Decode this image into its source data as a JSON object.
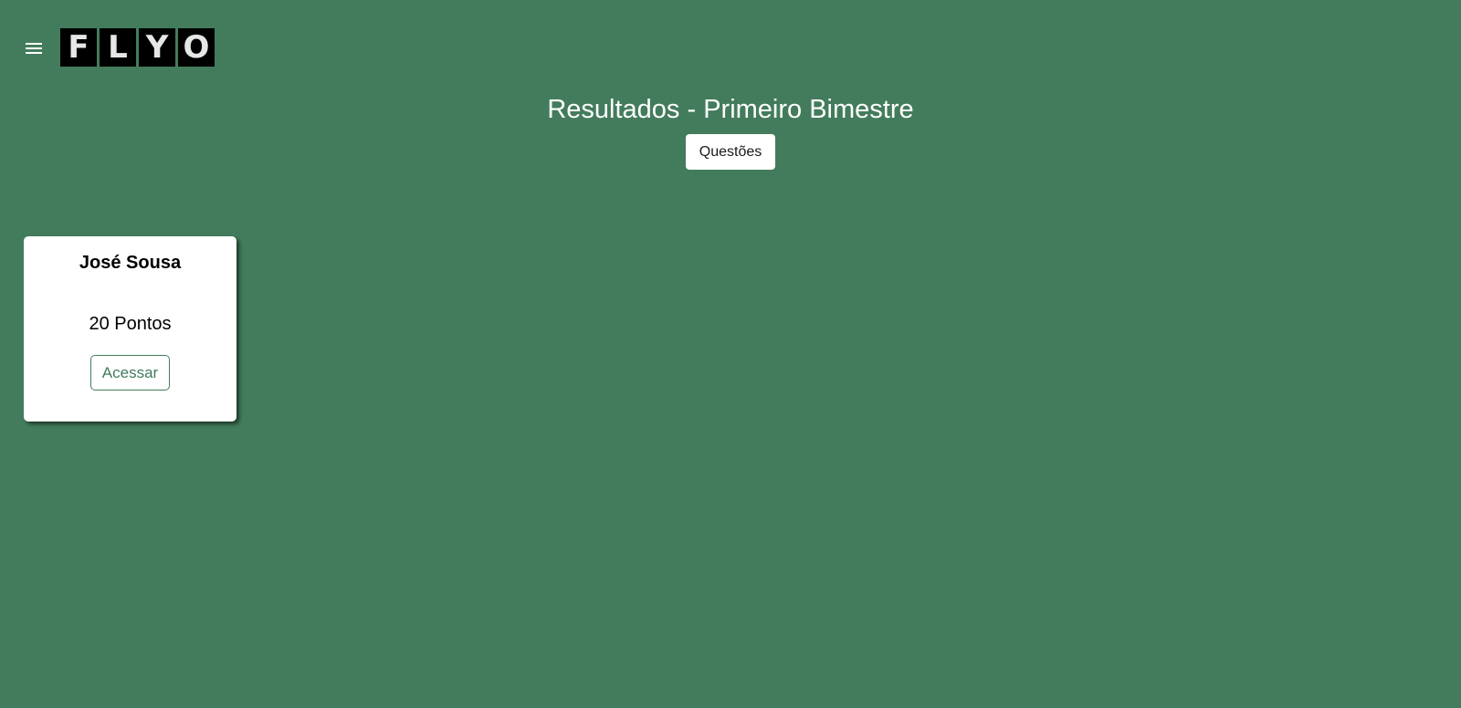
{
  "colors": {
    "background": "#437c5c",
    "card_background": "#ffffff",
    "accent": "#437c5c",
    "logo_tile": "#000000"
  },
  "header": {
    "menu_icon": "hamburger-menu-icon",
    "logo": {
      "letters": [
        "F",
        "L",
        "Y",
        "O"
      ]
    }
  },
  "main": {
    "title": "Resultados - Primeiro Bimestre",
    "questions_button_label": "Questões"
  },
  "results": [
    {
      "name": "José Sousa",
      "points_label": "20 Pontos",
      "access_label": "Acessar"
    }
  ]
}
